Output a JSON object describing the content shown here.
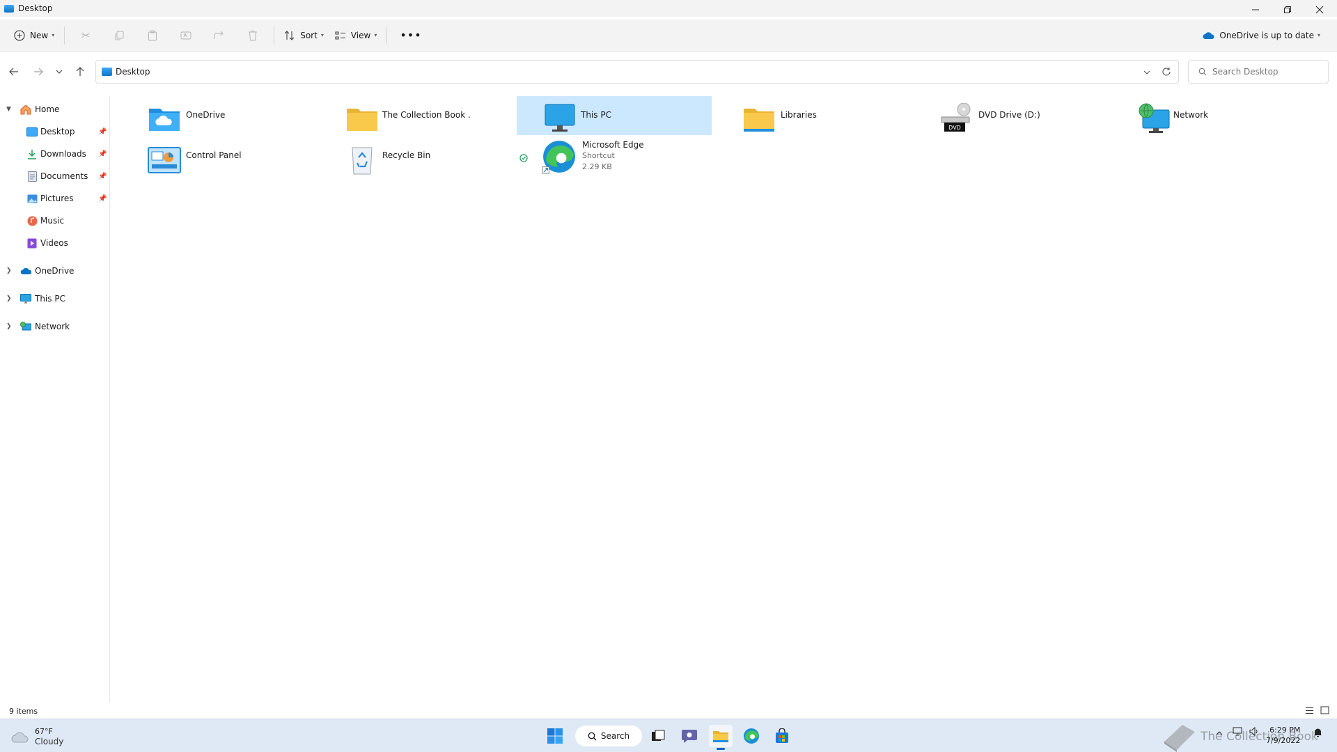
{
  "window": {
    "title": "Desktop"
  },
  "command_bar": {
    "new_label": "New",
    "sort_label": "Sort",
    "view_label": "View",
    "onedrive_status": "OneDrive is up to date"
  },
  "address": {
    "location": "Desktop"
  },
  "search": {
    "placeholder": "Search Desktop"
  },
  "sidebar": {
    "home": "Home",
    "quick_access": [
      {
        "label": "Desktop",
        "pinned": true
      },
      {
        "label": "Downloads",
        "pinned": true
      },
      {
        "label": "Documents",
        "pinned": true
      },
      {
        "label": "Pictures",
        "pinned": true
      },
      {
        "label": "Music",
        "pinned": false
      },
      {
        "label": "Videos",
        "pinned": false
      }
    ],
    "roots": [
      {
        "label": "OneDrive"
      },
      {
        "label": "This PC"
      },
      {
        "label": "Network"
      }
    ]
  },
  "items": [
    {
      "name": "OneDrive",
      "icon": "onedrive-folder-icon"
    },
    {
      "name": "The Collection Book .",
      "icon": "folder-icon"
    },
    {
      "name": "This PC",
      "icon": "this-pc-icon",
      "selected": true
    },
    {
      "name": "Libraries",
      "icon": "libraries-folder-icon"
    },
    {
      "name": "DVD Drive (D:)",
      "icon": "dvd-drive-icon",
      "badge": "DVD"
    },
    {
      "name": "Network",
      "icon": "network-icon"
    },
    {
      "name": "Control Panel",
      "icon": "control-panel-icon"
    },
    {
      "name": "Recycle Bin",
      "icon": "recycle-bin-icon"
    },
    {
      "name": "Microsoft Edge",
      "icon": "edge-icon",
      "type": "Shortcut",
      "size": "2.29 KB",
      "sync_status": "synced"
    }
  ],
  "status_bar": {
    "count": "9 items"
  },
  "taskbar": {
    "weather_temp": "67°F",
    "weather_desc": "Cloudy",
    "search_label": "Search",
    "watermark": "The Collection Book",
    "time": "6:29 PM",
    "date": "7/9/2022"
  },
  "colors": {
    "selected_bg": "#cce8ff",
    "accent": "#0067c0",
    "folder": "#f8c94a"
  }
}
